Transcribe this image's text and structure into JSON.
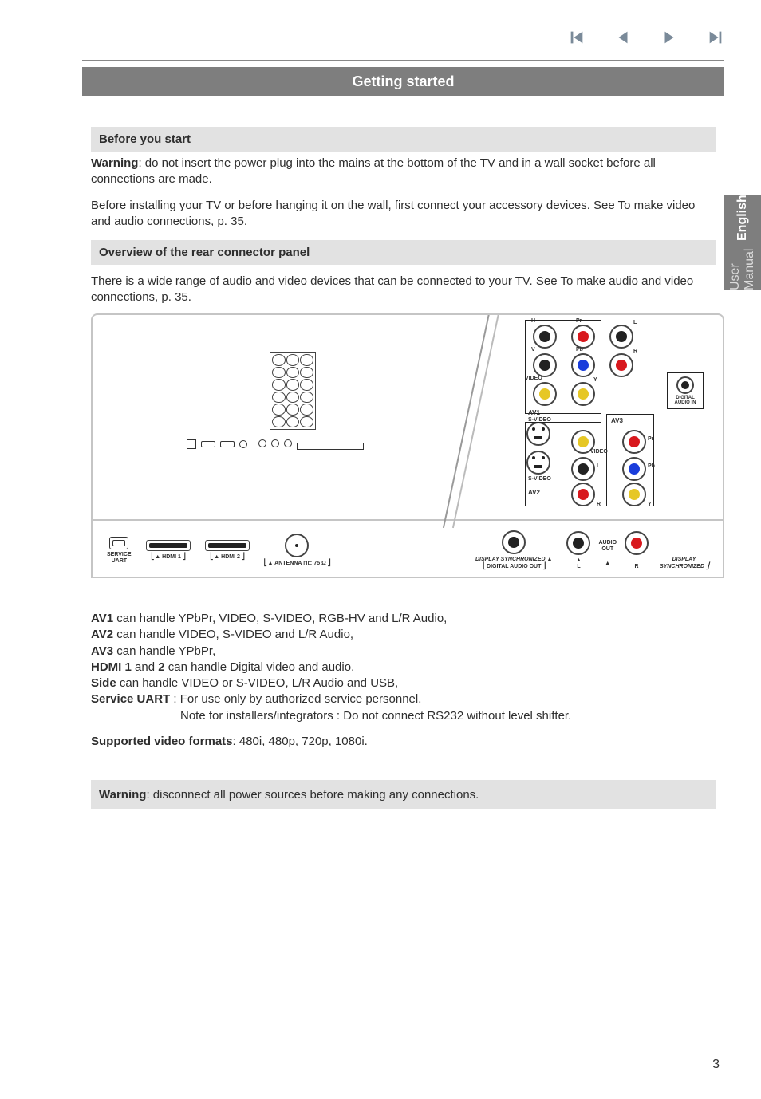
{
  "nav": {
    "first_icon": "skip-back",
    "prev_icon": "prev",
    "play_icon": "play",
    "last_icon": "skip-fwd"
  },
  "title": "Getting started",
  "sections": {
    "before": "Before you start",
    "overview": "Overview of the rear connector panel"
  },
  "paragraphs": {
    "warning1_bold": "Warning",
    "warning1": ": do not insert the power plug into the mains at the bottom of the TV and in a wall socket before all connections are made.",
    "before_install": "Before installing your TV or before hanging it on the wall, first connect your accessory devices. See To make video and audio connections, p. 35.",
    "wide_range": "There is a wide range of audio and video devices that can be connected to your TV.  See To make audio and video connections, p. 35."
  },
  "diagram": {
    "top_labels": {
      "H": "H",
      "Pr": "Pr",
      "L": "L",
      "V": "V",
      "Pb": "Pb",
      "R": "R",
      "VIDEO": "VIDEO",
      "Y": "Y",
      "DAI": "DIGITAL AUDIO IN",
      "AV1": "AV1",
      "SVIDEO": "S-VIDEO",
      "AV3": "AV3",
      "AV2": "AV2"
    },
    "bottom": {
      "service": "SERVICE\nUART",
      "hdmi1": "HDMI 1",
      "hdmi2": "HDMI 2",
      "antenna": "ANTENNA ⊓⊏ 75 Ω",
      "dao_top": "DISPLAY SYNCHRONIZED",
      "dao": "DIGITAL AUDIO OUT",
      "l": "L",
      "r": "R",
      "audio": "AUDIO",
      "out": "OUT",
      "ds": "DISPLAY",
      "sync": "SYNCHRONIZED"
    }
  },
  "conn": {
    "av1_b": "AV1",
    "av1": " can handle YPbPr, VIDEO, S-VIDEO, RGB-HV and L/R Audio,",
    "av2_b": "AV2",
    "av2": " can handle VIDEO, S-VIDEO and L/R Audio,",
    "av3_b": "AV3",
    "av3": " can handle YPbPr,",
    "hdmi_b": "HDMI 1",
    "hdmi_mid": " and ",
    "hdmi_b2": "2",
    "hdmi": " can handle Digital video and audio,",
    "side_b": "Side",
    "side": " can handle VIDEO or S-VIDEO, L/R Audio and USB,",
    "serv_b": "Service UART",
    "serv": " : For use only by authorized service personnel.",
    "note": "Note for installers/integrators : Do not connect RS232 without level shifter."
  },
  "formats_b": "Supported video formats",
  "formats": ": 480i, 480p, 720p, 1080i.",
  "warning2_b": "Warning",
  "warning2": ": disconnect all power sources before making any connections.",
  "side_tab": {
    "eng": "English",
    "um": "User Manual"
  },
  "page": "3"
}
